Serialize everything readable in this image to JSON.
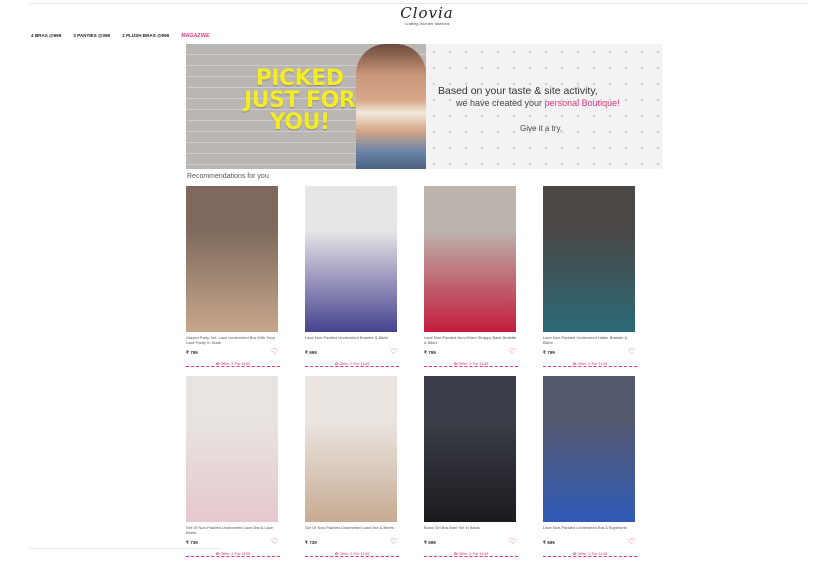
{
  "header": {
    "brand": "Clovia",
    "tagline": "Crafting Wonder fashions"
  },
  "nav": {
    "items": [
      "4 BRAS @699",
      "3 PANTIES @399",
      "2 PLUSH BRAS @999"
    ],
    "magazine": "MAGAZINE"
  },
  "banner": {
    "headline_1": "PICKED",
    "headline_2": "JUST FOR",
    "headline_3": "YOU!",
    "line1": "Based on your taste & site activity,",
    "line2_prefix": "we have created your ",
    "line2_highlight": "personal Boutique!",
    "line3": "Give it a try."
  },
  "section_title": "Recommendations for you",
  "products": [
    {
      "name": "Glazed Party Set: Lace Underwired Bra With Sexy Lace Panty In Nude",
      "price": "₹ 799",
      "offer": "Offer: 2 For 1149",
      "img_top": "#7e6a5c",
      "img_bottom": "#c6a78c"
    },
    {
      "name": "Lace Non-Padded Underwired Bralette & Bikini",
      "price": "₹ 699",
      "offer": "Offer: 2 For 1149",
      "img_top": "#e9e6e8",
      "img_bottom": "#46438f"
    },
    {
      "name": "Lace Non-Padded Non-Wired Strappy Back Bralette & Bikini",
      "price": "₹ 799",
      "offer": "Offer: 2 For 1149",
      "img_top": "#bdb4ad",
      "img_bottom": "#c21d3a"
    },
    {
      "name": "Lace Non-Padded Underwired Halter Bralette & Bikini",
      "price": "₹ 799",
      "offer": "Offer: 2 For 1149",
      "img_top": "#4a4745",
      "img_bottom": "#2b6a78"
    },
    {
      "name": "Set Of Non-Padded Underwired Lace Bra & Lace Briefs",
      "price": "₹ 739",
      "offer": "Offer: 2 For 1199",
      "img_top": "#e8e4e1",
      "img_bottom": "#e6c8cc"
    },
    {
      "name": "Set Of Non-Padded Underwired Lace Bra & Briefs",
      "price": "₹ 739",
      "offer": "Offer: 2 For 1199",
      "img_top": "#ebe6e2",
      "img_bottom": "#c7ab92"
    },
    {
      "name": "Bond Girl Bra Brief Set In Black",
      "price": "₹ 599",
      "offer": "Offer: 2 For 1149",
      "img_top": "#3b3e48",
      "img_bottom": "#1b1b1f"
    },
    {
      "name": "Lace Non-Padded Underwired Bra & Boyshorts",
      "price": "₹ 699",
      "offer": "Offer: 2 For 1149",
      "img_top": "#55596e",
      "img_bottom": "#2f5ab8"
    }
  ],
  "colors": {
    "accent": "#e2337b",
    "headline": "#f3ec27"
  }
}
